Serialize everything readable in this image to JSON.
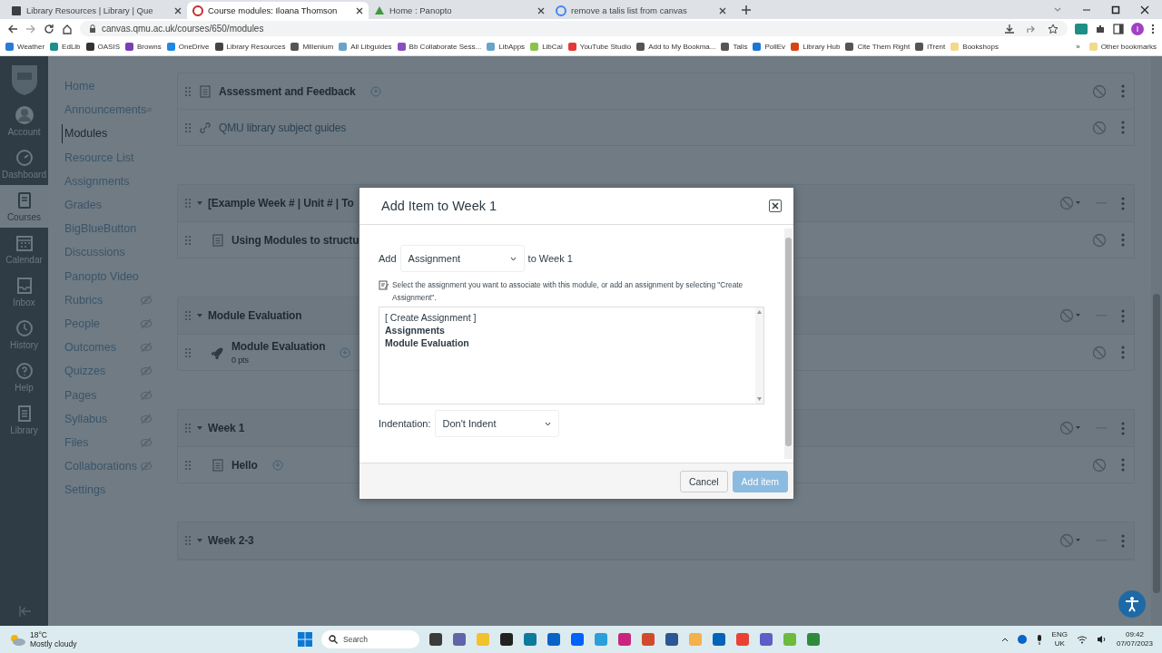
{
  "browser": {
    "tabs": [
      {
        "title": "Library Resources | Library | Que",
        "selected": false
      },
      {
        "title": "Course modules: Iloana Thomson",
        "selected": true
      },
      {
        "title": "Home : Panopto",
        "selected": false
      },
      {
        "title": "remove a talis list from canvas",
        "selected": false
      }
    ],
    "url": "canvas.qmu.ac.uk/courses/650/modules",
    "profile_initial": "I",
    "bookmarks": [
      {
        "label": "Weather",
        "color": "#2b7bd6"
      },
      {
        "label": "EdLib",
        "color": "#1d8f8f"
      },
      {
        "label": "OASIS",
        "color": "#333333"
      },
      {
        "label": "Browns",
        "color": "#7b3fb5"
      },
      {
        "label": "OneDrive",
        "color": "#1e88e5"
      },
      {
        "label": "Library Resources",
        "color": "#444444"
      },
      {
        "label": "Millenium",
        "color": "#555555"
      },
      {
        "label": "All Libguides",
        "color": "#6aa3c8"
      },
      {
        "label": "Bb Collaborate Sess...",
        "color": "#8a4fbf"
      },
      {
        "label": "LibApps",
        "color": "#6aa3c8"
      },
      {
        "label": "LibCal",
        "color": "#8bc34a"
      },
      {
        "label": "YouTube Studio",
        "color": "#e53935"
      },
      {
        "label": "Add to My Bookma...",
        "color": "#555555"
      },
      {
        "label": "Talis",
        "color": "#555555"
      },
      {
        "label": "PollEv",
        "color": "#1976d2"
      },
      {
        "label": "Library Hub",
        "color": "#d84315"
      },
      {
        "label": "Cite Them Right",
        "color": "#555555"
      },
      {
        "label": "iTrent",
        "color": "#555555"
      },
      {
        "label": "Bookshops",
        "color": "#f3d98b"
      }
    ],
    "more_bookmarks": "»",
    "other_bookmarks": "Other bookmarks"
  },
  "global_nav": [
    {
      "label": "Account",
      "selected": false
    },
    {
      "label": "Dashboard",
      "selected": false
    },
    {
      "label": "Courses",
      "selected": true
    },
    {
      "label": "Calendar",
      "selected": false
    },
    {
      "label": "Inbox",
      "selected": false
    },
    {
      "label": "History",
      "selected": false
    },
    {
      "label": "Help",
      "selected": false
    },
    {
      "label": "Library",
      "selected": false
    }
  ],
  "course_nav": [
    {
      "label": "Home",
      "selected": false,
      "hidden": false
    },
    {
      "label": "Announcements",
      "selected": false,
      "hidden": true
    },
    {
      "label": "Modules",
      "selected": true,
      "hidden": false
    },
    {
      "label": "Resource List",
      "selected": false,
      "hidden": false
    },
    {
      "label": "Assignments",
      "selected": false,
      "hidden": false
    },
    {
      "label": "Grades",
      "selected": false,
      "hidden": false
    },
    {
      "label": "BigBlueButton",
      "selected": false,
      "hidden": false
    },
    {
      "label": "Discussions",
      "selected": false,
      "hidden": false
    },
    {
      "label": "Panopto Video",
      "selected": false,
      "hidden": false
    },
    {
      "label": "Rubrics",
      "selected": false,
      "hidden": true
    },
    {
      "label": "People",
      "selected": false,
      "hidden": true
    },
    {
      "label": "Outcomes",
      "selected": false,
      "hidden": true
    },
    {
      "label": "Quizzes",
      "selected": false,
      "hidden": true
    },
    {
      "label": "Pages",
      "selected": false,
      "hidden": true
    },
    {
      "label": "Syllabus",
      "selected": false,
      "hidden": true
    },
    {
      "label": "Files",
      "selected": false,
      "hidden": true
    },
    {
      "label": "Collaborations",
      "selected": false,
      "hidden": true
    },
    {
      "label": "Settings",
      "selected": false,
      "hidden": false
    }
  ],
  "modules": [
    {
      "items": [
        {
          "title": "Assessment and Feedback",
          "kind": "page",
          "indented": false,
          "tagged": true
        },
        {
          "title": "QMU library subject guides",
          "kind": "link",
          "indented": false,
          "tagged": false
        }
      ]
    },
    {
      "title": "[Example Week # | Unit # | To",
      "items": [
        {
          "title": "Using Modules to structu",
          "kind": "page",
          "indented": true
        }
      ]
    },
    {
      "title": "Module Evaluation",
      "items": [
        {
          "title": "Module Evaluation",
          "kind": "quiz",
          "indented": true,
          "tagged": true,
          "points": "0 pts"
        }
      ]
    },
    {
      "title": "Week 1",
      "items": [
        {
          "title": "Hello",
          "kind": "page",
          "indented": true,
          "tagged": true
        }
      ]
    },
    {
      "title": "Week 2-3"
    }
  ],
  "dialog": {
    "title": "Add Item to Week 1",
    "add_label": "Add",
    "item_type": "Assignment",
    "target": "to Week 1",
    "hint": "Select the assignment you want to associate with this module, or add an assignment by selecting \"Create Assignment\".",
    "options": [
      {
        "label": "[ Create Assignment ]",
        "kind": "option"
      },
      {
        "label": "Assignments",
        "kind": "group"
      },
      {
        "label": "Module Evaluation",
        "kind": "group"
      }
    ],
    "indent_label": "Indentation:",
    "indent_value": "Don't Indent",
    "cancel": "Cancel",
    "submit": "Add item"
  },
  "taskbar": {
    "temperature": "18°C",
    "weather": "Mostly cloudy",
    "search_placeholder": "Search",
    "language": "ENG",
    "region": "UK",
    "time": "09:42",
    "date": "07/07/2023"
  }
}
